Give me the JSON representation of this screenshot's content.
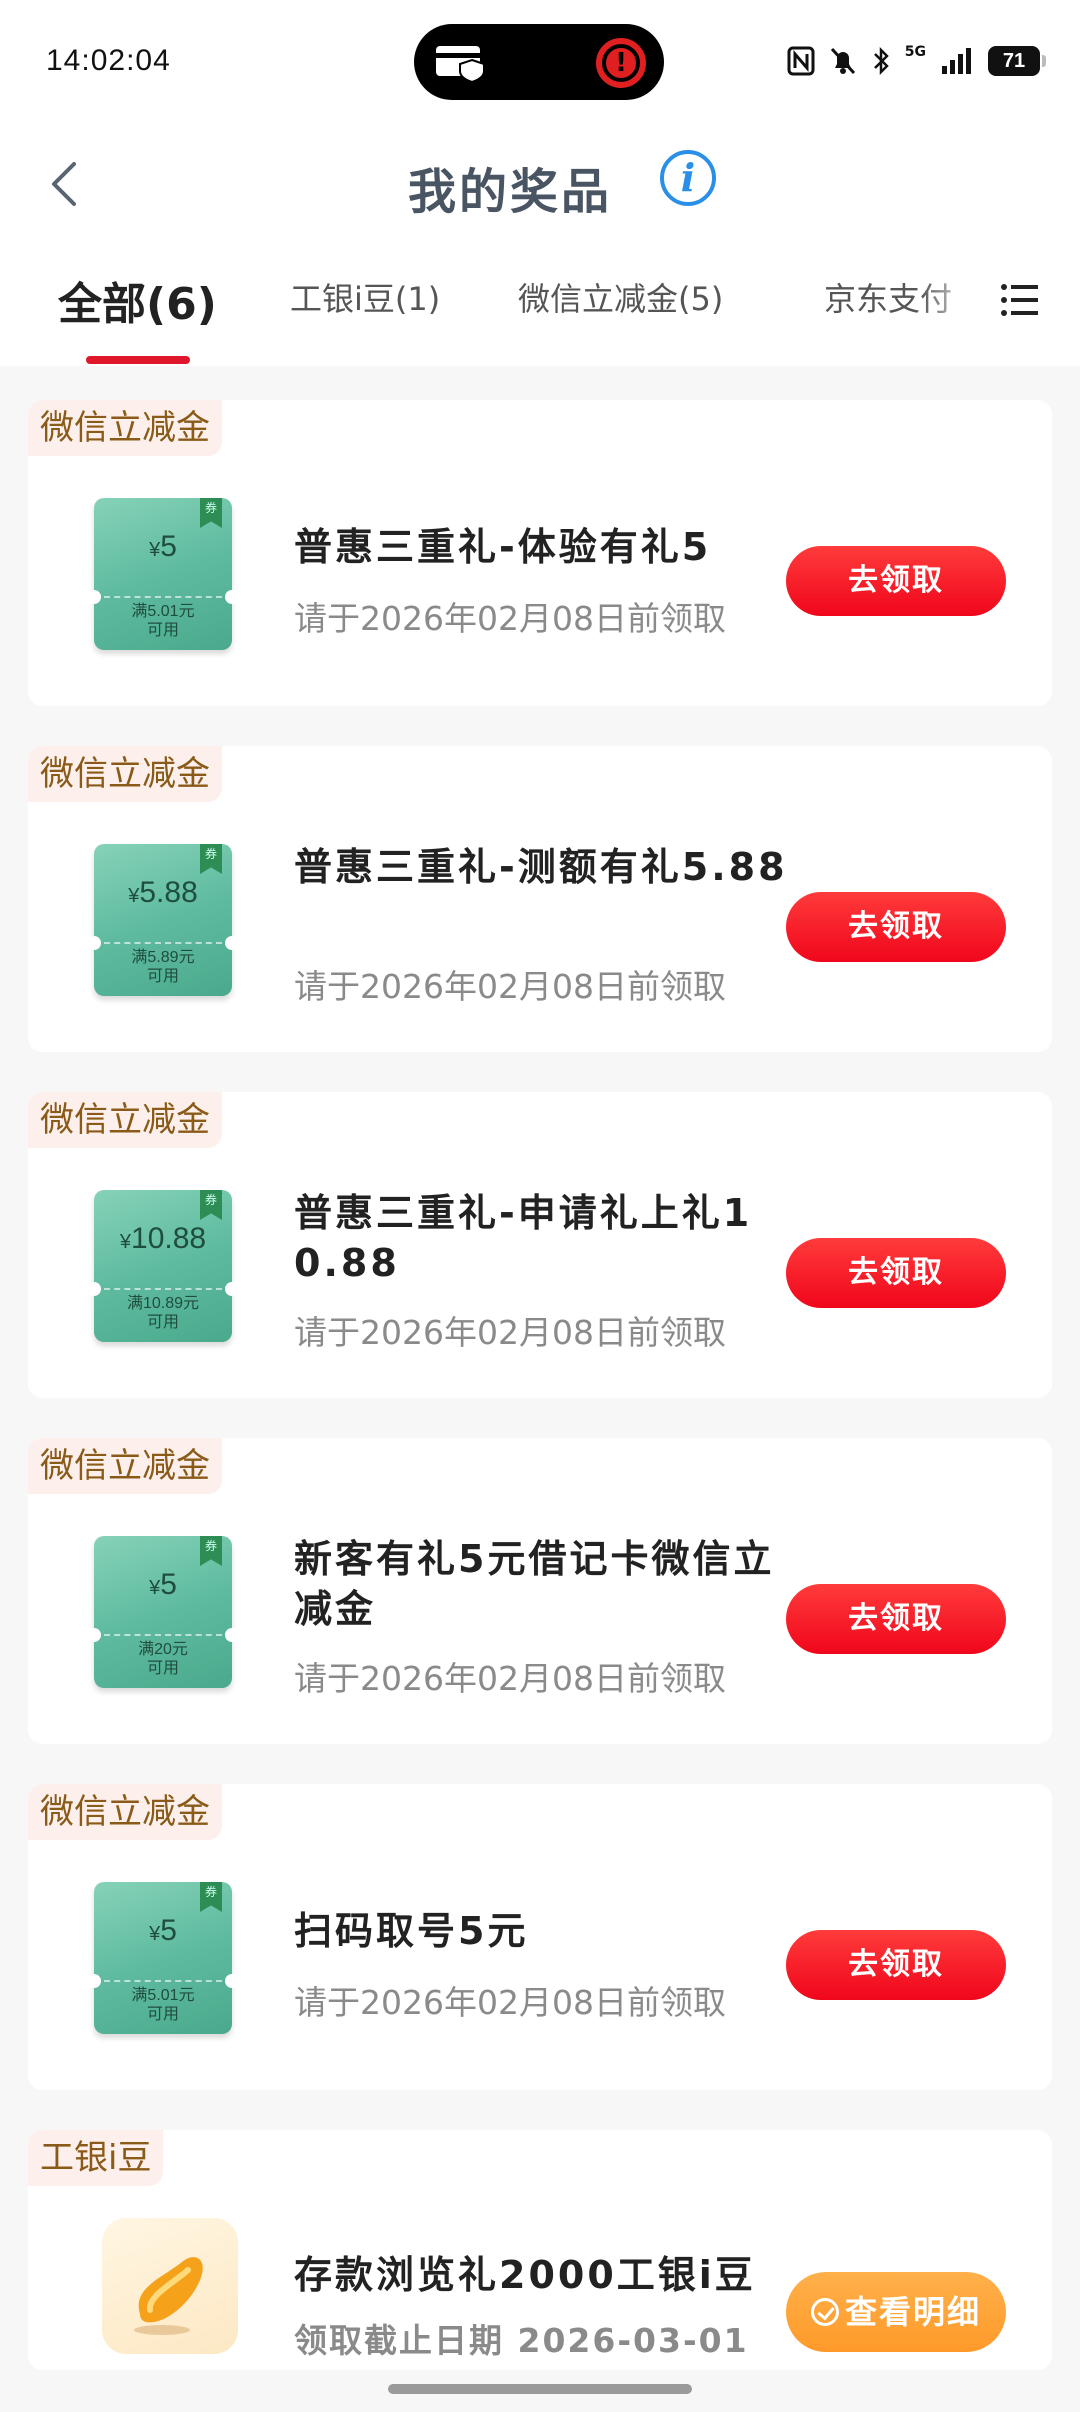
{
  "status_bar": {
    "time": "14:02:04",
    "network": "5G",
    "battery": "71",
    "icons": [
      "card-shield-icon",
      "alert-icon",
      "nfc-icon",
      "bell-muted-icon",
      "bluetooth-icon",
      "signal-icon",
      "battery-icon"
    ]
  },
  "header": {
    "title": "我的奖品",
    "info": "i"
  },
  "tabs": [
    {
      "label": "全部(6)",
      "active": true
    },
    {
      "label": "工银i豆(1)"
    },
    {
      "label": "微信立减金(5)"
    },
    {
      "label": "京东支付"
    }
  ],
  "cards": [
    {
      "tag": "微信立减金",
      "coupon_ribbon": "券",
      "coupon_currency": "¥",
      "coupon_amount": "5",
      "coupon_condition_1": "满5.01元",
      "coupon_condition_2": "可用",
      "title": "普惠三重礼-体验有礼5",
      "deadline": "请于2026年02月08日前领取",
      "button": "去领取"
    },
    {
      "tag": "微信立减金",
      "coupon_ribbon": "券",
      "coupon_currency": "¥",
      "coupon_amount": "5.88",
      "coupon_condition_1": "满5.89元",
      "coupon_condition_2": "可用",
      "title": "普惠三重礼-测额有礼5.88",
      "deadline": "请于2026年02月08日前领取",
      "button": "去领取"
    },
    {
      "tag": "微信立减金",
      "coupon_ribbon": "券",
      "coupon_currency": "¥",
      "coupon_amount": "10.88",
      "coupon_condition_1": "满10.89元",
      "coupon_condition_2": "可用",
      "title": "普惠三重礼-申请礼上礼10.88",
      "deadline": "请于2026年02月08日前领取",
      "button": "去领取"
    },
    {
      "tag": "微信立减金",
      "coupon_ribbon": "券",
      "coupon_currency": "¥",
      "coupon_amount": "5",
      "coupon_condition_1": "满20元",
      "coupon_condition_2": "可用",
      "title": "新客有礼5元借记卡微信立减金",
      "deadline": "请于2026年02月08日前领取",
      "button": "去领取"
    },
    {
      "tag": "微信立减金",
      "coupon_ribbon": "券",
      "coupon_currency": "¥",
      "coupon_amount": "5",
      "coupon_condition_1": "满5.01元",
      "coupon_condition_2": "可用",
      "title": "扫码取号5元",
      "deadline": "请于2026年02月08日前领取",
      "button": "去领取"
    },
    {
      "tag": "工银i豆",
      "title": "存款浏览礼2000工银i豆",
      "deadline": "领取截止日期 2026-03-01",
      "button": "查看明细"
    }
  ]
}
